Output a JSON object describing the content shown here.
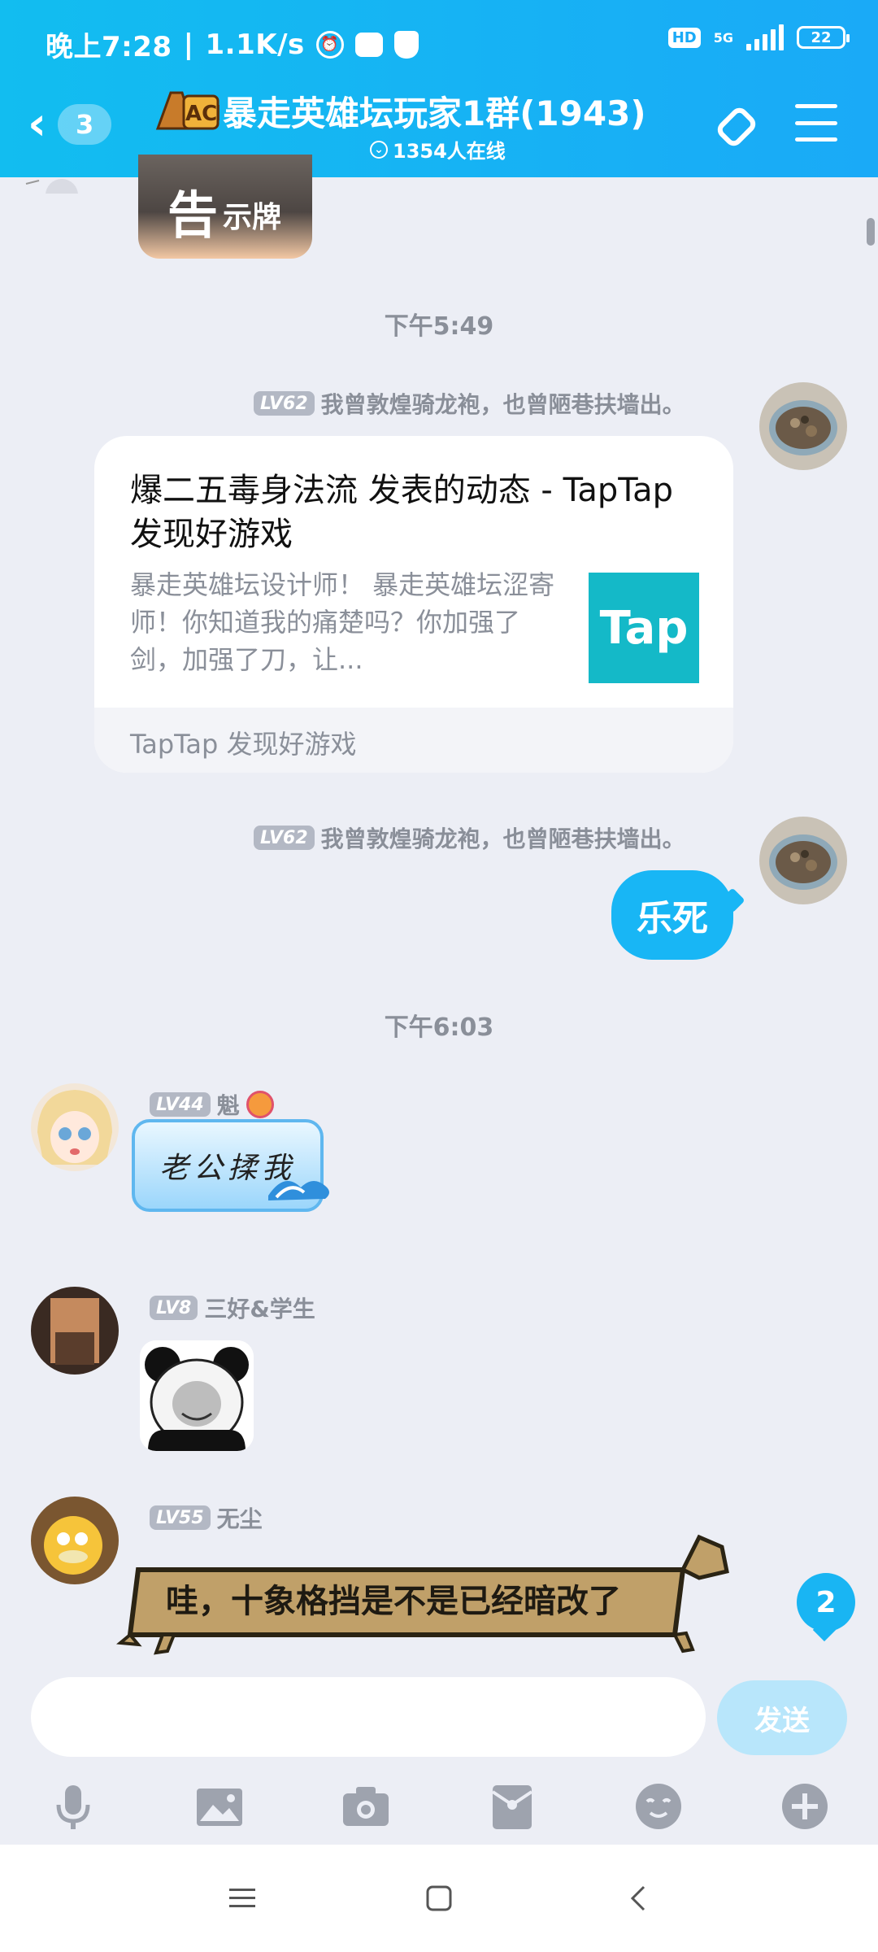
{
  "status_bar": {
    "time": "晚上7:28",
    "speed": "1.1K/s",
    "hd": "HD",
    "network": "5G",
    "battery": "22"
  },
  "header": {
    "back_count": "3",
    "logo_text": "ACE",
    "title": "暴走英雄坛玩家1群(1943)",
    "online": "1354人在线"
  },
  "messages": {
    "notice_big": "告",
    "notice_small": "示牌",
    "time1": "下午5:49",
    "msg1": {
      "level": "LV62",
      "sender": "我曾敦煌骑龙袍，也曾陋巷扶墙出。",
      "card_title": "爆二五毒身法流 发表的动态 - TapTap 发现好游戏",
      "card_desc": "暴走英雄坛设计师！ 暴走英雄坛涩寄师！你知道我的痛楚吗？你加强了剑，加强了刀，让...",
      "card_logo": "Tap",
      "card_source": "TapTap 发现好游戏"
    },
    "msg2": {
      "level": "LV62",
      "sender": "我曾敦煌骑龙袍，也曾陋巷扶墙出。",
      "text": "乐死"
    },
    "time2": "下午6:03",
    "msg3": {
      "level": "LV44",
      "sender": "魁",
      "text": "老公揉我"
    },
    "msg4": {
      "level": "LV8",
      "sender": "三好&学生"
    },
    "msg5": {
      "level": "LV55",
      "sender": "无尘",
      "text": "哇，十象格挡是不是已经暗改了"
    },
    "unread": "2"
  },
  "input": {
    "value": "",
    "send_label": "发送"
  },
  "colors": {
    "header": "#16b3f4",
    "accent_blue": "#18b6f5",
    "background": "#eceef5"
  },
  "toolbar_icons": [
    "microphone-icon",
    "image-icon",
    "camera-icon",
    "red-packet-icon",
    "emoji-icon",
    "plus-icon"
  ],
  "nav_icons": [
    "menu-icon",
    "home-icon",
    "back-icon"
  ]
}
